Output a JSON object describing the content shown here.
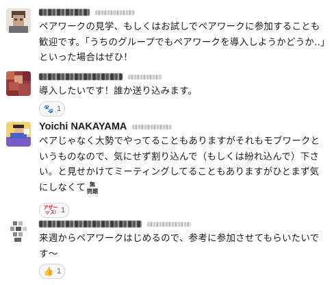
{
  "messages": [
    {
      "author": "",
      "text": "ペアワークの見学、もしくはお試しでペアワークに参加することも歓迎です。「うちのグループでもペアワークを導入しようかどうか..」といった場合はぜひ！",
      "reactions": []
    },
    {
      "author": "",
      "text": "導入したいです！誰か送り込みます。",
      "reactions": [
        {
          "emoji": "paw-prints",
          "glyph": "🐾",
          "count": "1"
        }
      ]
    },
    {
      "author": "Yoichi NAKAYAMA",
      "text": "ペアじゃなく大勢でやってることもありますがそれもモブワークというものなので、気にせず割り込んで（もしくは紛れ込んで）下さい。と見せかけてミーティングしてることもありますがひとまず気にしなくて",
      "inline_emoji": {
        "name": "mondai-nai",
        "line1": "無",
        "line2": "問題"
      },
      "reactions": [
        {
          "emoji": "agree-stamp",
          "glyph": "アザー\nッス!",
          "count": "1"
        }
      ]
    },
    {
      "author": "",
      "text": "来週からペアワークはじめるので、参考に参加させてもらいたいです〜",
      "reactions": [
        {
          "emoji": "thumbs-up",
          "glyph": "👍",
          "count": "1"
        }
      ]
    }
  ],
  "colors": {
    "text": "#1d1c1d",
    "reaction_border": "#d9d9d9",
    "reaction_bg": "#f8f8f8"
  }
}
